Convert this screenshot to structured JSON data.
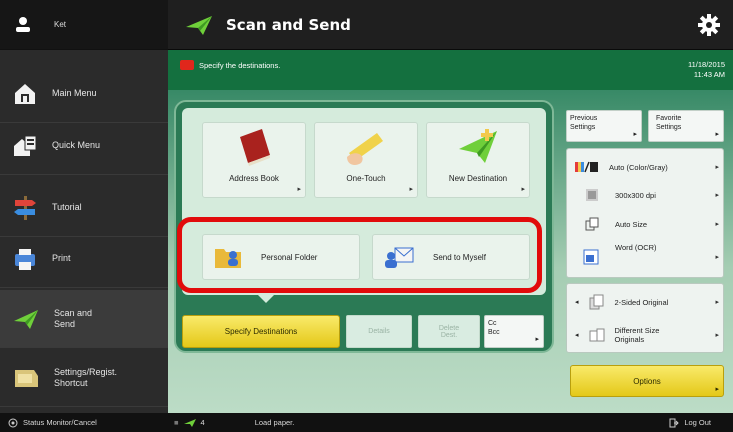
{
  "sidebar": {
    "user": "Ket",
    "items": [
      {
        "label": "Main Menu",
        "icon": "home-icon"
      },
      {
        "label": "Quick Menu",
        "icon": "quick-menu-icon"
      },
      {
        "label": "Tutorial",
        "icon": "signpost-icon"
      },
      {
        "label": "Print",
        "icon": "print-icon"
      },
      {
        "label": "Scan and Send",
        "icon": "scan-send-icon"
      },
      {
        "label": "Settings/Regist. Shortcut",
        "icon": "settings-shortcut-icon"
      }
    ]
  },
  "header": {
    "title": "Scan and Send"
  },
  "message": {
    "text": "Specify the destinations.",
    "date": "11/18/2015",
    "time": "11:43 AM"
  },
  "destinations": {
    "address_book": "Address Book",
    "one_touch": "One-Touch",
    "new_destination": "New Destination",
    "personal_folder": "Personal Folder",
    "send_to_myself": "Send to Myself"
  },
  "bottom_buttons": {
    "specify": "Specify Destinations",
    "details": "Details",
    "delete_dest": "Delete Dest.",
    "cc_bcc": "Cc Bcc"
  },
  "right_panel": {
    "previous_settings": "Previous Settings",
    "favorite_settings": "Favorite Settings",
    "color": "Auto (Color/Gray)",
    "resolution": "300x300 dpi",
    "size": "Auto Size",
    "file_format": "Word (OCR)",
    "two_sided": "2-Sided Original",
    "different_size": "Different Size Originals",
    "options": "Options"
  },
  "status_bar": {
    "monitor": "Status Monitor/Cancel",
    "job_count": "4",
    "message": "Load paper.",
    "logout": "Log Out"
  },
  "colors": {
    "accent_green": "#14703f",
    "highlight_red": "#e10b0b",
    "yellow": "#e4c818"
  }
}
